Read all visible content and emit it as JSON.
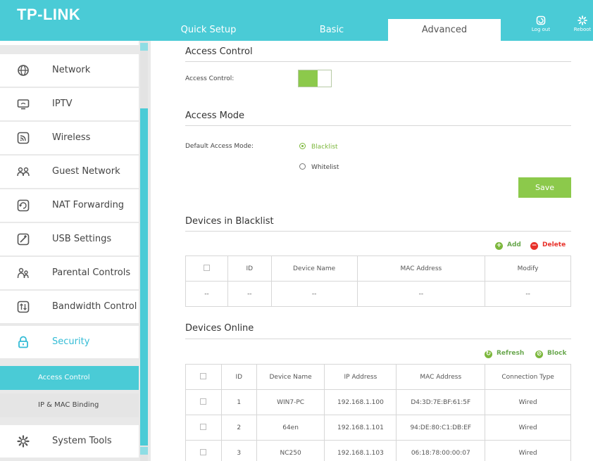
{
  "header": {
    "logo": "TP-LINK",
    "tabs": [
      "Quick Setup",
      "Basic",
      "Advanced"
    ],
    "logout_label": "Log out",
    "reboot_label": "Reboot"
  },
  "sidebar": {
    "items": [
      {
        "label": "Network",
        "icon": "globe-icon"
      },
      {
        "label": "IPTV",
        "icon": "tv-icon"
      },
      {
        "label": "Wireless",
        "icon": "wireless-icon"
      },
      {
        "label": "Guest Network",
        "icon": "guest-network-icon"
      },
      {
        "label": "NAT Forwarding",
        "icon": "nat-forwarding-icon"
      },
      {
        "label": "USB Settings",
        "icon": "usb-icon"
      },
      {
        "label": "Parental Controls",
        "icon": "parental-controls-icon"
      },
      {
        "label": "Bandwidth Control",
        "icon": "bandwidth-icon"
      },
      {
        "label": "Security",
        "icon": "lock-icon"
      },
      {
        "label": "System Tools",
        "icon": "gear-icon"
      }
    ],
    "sub_items": [
      "Access Control",
      "IP & MAC Binding"
    ]
  },
  "access_control": {
    "title": "Access Control",
    "label": "Access Control:",
    "enabled": true
  },
  "access_mode": {
    "title": "Access Mode",
    "label": "Default Access Mode:",
    "options": [
      "Blacklist",
      "Whitelist"
    ],
    "selected": "Blacklist",
    "save_label": "Save"
  },
  "blacklist": {
    "title": "Devices in Blacklist",
    "add_label": "Add",
    "delete_label": "Delete",
    "columns": [
      "ID",
      "Device Name",
      "MAC Address",
      "Modify"
    ],
    "rows": [
      [
        "--",
        "--",
        "--",
        "--",
        "--"
      ]
    ]
  },
  "online": {
    "title": "Devices Online",
    "refresh_label": "Refresh",
    "block_label": "Block",
    "columns": [
      "ID",
      "Device Name",
      "IP Address",
      "MAC Address",
      "Connection Type"
    ],
    "rows": [
      [
        "1",
        "WIN7-PC",
        "192.168.1.100",
        "D4:3D:7E:BF:61:5F",
        "Wired"
      ],
      [
        "2",
        "64en",
        "192.168.1.101",
        "94:DE:80:C1:DB:EF",
        "Wired"
      ],
      [
        "3",
        "NC250",
        "192.168.1.103",
        "06:18:78:00:00:07",
        "Wired"
      ]
    ]
  },
  "colors": {
    "brand": "#4acbd6",
    "accent_green": "#8cc94b",
    "delete_red": "#e8312a"
  }
}
